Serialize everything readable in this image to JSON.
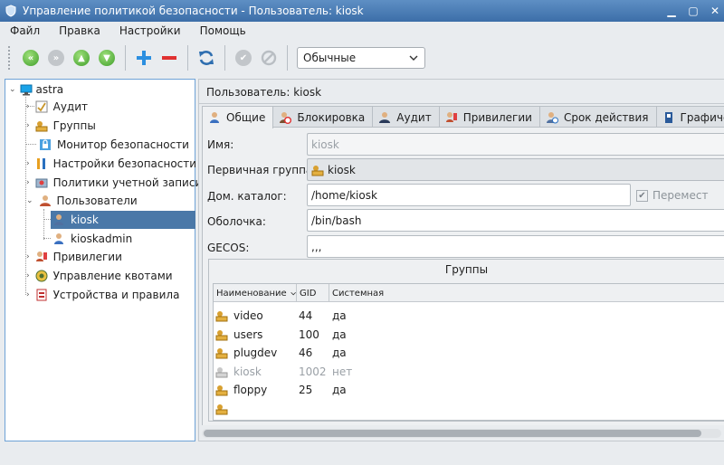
{
  "window": {
    "title": "Управление политикой безопасности - Пользователь: kiosk"
  },
  "menu": [
    "Файл",
    "Правка",
    "Настройки",
    "Помощь"
  ],
  "toolbar": {
    "mode_value": "Обычные"
  },
  "tree": {
    "root": "astra",
    "items": [
      {
        "label": "Аудит"
      },
      {
        "label": "Группы"
      },
      {
        "label": "Монитор безопасности"
      },
      {
        "label": "Настройки безопасности"
      },
      {
        "label": "Политики учетной записи"
      },
      {
        "label": "Пользователи"
      },
      {
        "label": "kiosk"
      },
      {
        "label": "kioskadmin"
      },
      {
        "label": "Привилегии"
      },
      {
        "label": "Управление квотами"
      },
      {
        "label": "Устройства и правила"
      }
    ]
  },
  "header": {
    "label": "Пользователь: kiosk"
  },
  "tabs": [
    "Общие",
    "Блокировка",
    "Аудит",
    "Привилегии",
    "Срок действия",
    "Графическ"
  ],
  "form": {
    "name_label": "Имя:",
    "name_value": "kiosk",
    "group_label": "Первичная группа:",
    "group_value": "kiosk",
    "home_label": "Дом. каталог:",
    "home_value": "/home/kiosk",
    "move_label": "Перемест",
    "shell_label": "Оболочка:",
    "shell_value": "/bin/bash",
    "gecos_label": "GECOS:",
    "gecos_value": ",,,"
  },
  "groups": {
    "title": "Группы",
    "columns": [
      "Наименование",
      "GID",
      "Системная"
    ],
    "rows": [
      {
        "name": "video",
        "gid": "44",
        "system": "да"
      },
      {
        "name": "users",
        "gid": "100",
        "system": "да"
      },
      {
        "name": "plugdev",
        "gid": "46",
        "system": "да"
      },
      {
        "name": "kiosk",
        "gid": "1002",
        "system": "нет"
      },
      {
        "name": "floppy",
        "gid": "25",
        "system": "да"
      }
    ]
  },
  "colors": {
    "titlebar": "#4a7ab5",
    "selection": "#4a78a8",
    "accent_green": "#4caf32",
    "plus_blue": "#2c8fe0",
    "minus_red": "#e03030"
  },
  "icons": [
    "app-icon",
    "first-icon",
    "prev-icon",
    "up-icon",
    "down-icon",
    "add-icon",
    "remove-icon",
    "refresh-icon",
    "apply-icon",
    "cancel-icon",
    "computer-icon",
    "user-icon",
    "group-icon",
    "lock-icon",
    "tools-icon",
    "policy-icon",
    "users-icon",
    "privileges-icon",
    "quota-icon",
    "devices-icon",
    "calendar-icon",
    "display-icon"
  ]
}
